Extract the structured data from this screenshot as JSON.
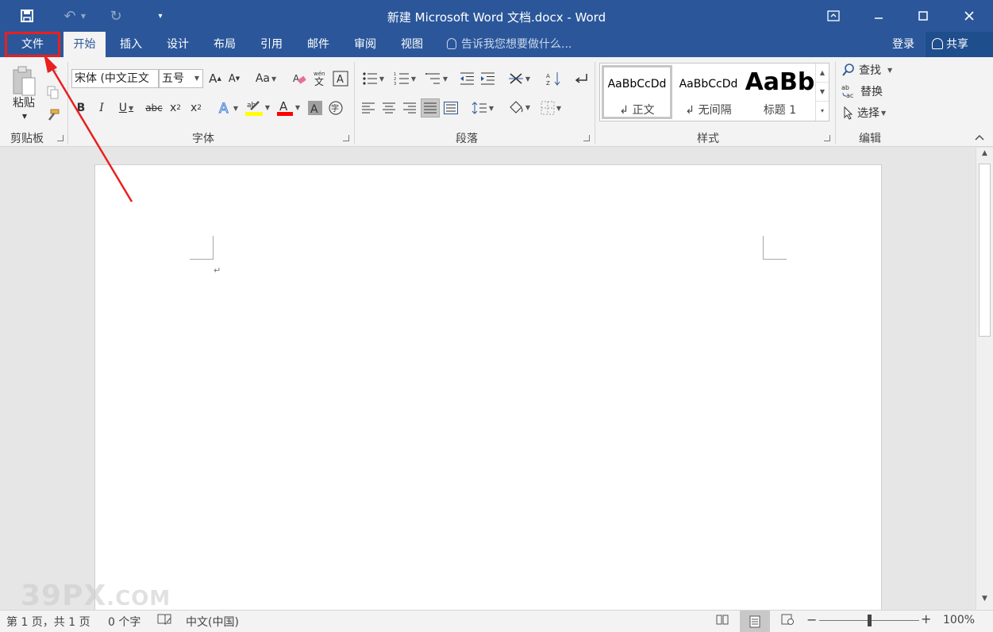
{
  "window": {
    "title": "新建 Microsoft Word 文档.docx - Word",
    "qat_icons": [
      "save-icon",
      "undo-icon",
      "redo-icon",
      "customize-qat-icon"
    ],
    "controls": [
      "ribbon-display-options-icon",
      "minimize-icon",
      "maximize-icon",
      "close-icon"
    ]
  },
  "tabs": {
    "file": "文件",
    "items": [
      "开始",
      "插入",
      "设计",
      "布局",
      "引用",
      "邮件",
      "审阅",
      "视图"
    ],
    "active": "开始",
    "tell_me": "告诉我您想要做什么...",
    "login": "登录",
    "share": "共享"
  },
  "ribbon": {
    "clipboard": {
      "label": "剪贴板",
      "paste": "粘贴"
    },
    "font": {
      "label": "字体",
      "font_name": "宋体 (中文正文",
      "font_size": "五号"
    },
    "paragraph": {
      "label": "段落"
    },
    "styles": {
      "label": "样式",
      "items": [
        {
          "sample": "AaBbCcDd",
          "name": "正文"
        },
        {
          "sample": "AaBbCcDd",
          "name": "无间隔"
        },
        {
          "sample": "AaBb",
          "name": "标题 1"
        }
      ]
    },
    "editing": {
      "label": "编辑",
      "find": "查找",
      "replace": "替换",
      "select": "选择"
    }
  },
  "status": {
    "page": "第 1 页，共 1 页",
    "words": "0 个字",
    "language": "中文(中国)",
    "zoom": "100%",
    "zoom_level": 0.5
  },
  "watermark": {
    "main": "39PX",
    "suffix": ".COM"
  },
  "colors": {
    "brand": "#2b579a",
    "highlight_annotation": "#e8201f",
    "highlighter_yellow": "#ffff00",
    "font_red": "#ff0000"
  }
}
